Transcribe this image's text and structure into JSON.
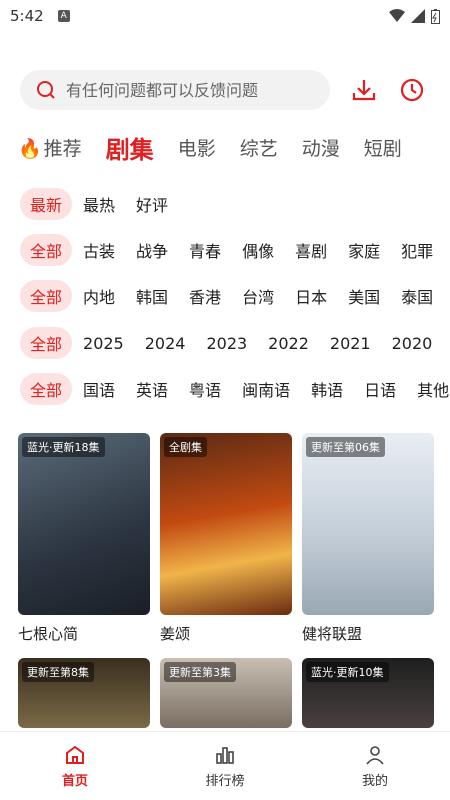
{
  "status": {
    "time": "5:42"
  },
  "search": {
    "placeholder": "有任何问题都可以反馈问题"
  },
  "tabs": [
    "推荐",
    "剧集",
    "电影",
    "综艺",
    "动漫",
    "短剧"
  ],
  "filters": {
    "sort": {
      "selected": "最新",
      "items": [
        "最热",
        "好评"
      ]
    },
    "genre": {
      "selected": "全部",
      "items": [
        "古装",
        "战争",
        "青春",
        "偶像",
        "喜剧",
        "家庭",
        "犯罪"
      ]
    },
    "region": {
      "selected": "全部",
      "items": [
        "内地",
        "韩国",
        "香港",
        "台湾",
        "日本",
        "美国",
        "泰国"
      ]
    },
    "year": {
      "selected": "全部",
      "items": [
        "2025",
        "2024",
        "2023",
        "2022",
        "2021",
        "2020"
      ]
    },
    "language": {
      "selected": "全部",
      "items": [
        "国语",
        "英语",
        "粤语",
        "闽南语",
        "韩语",
        "日语",
        "其他"
      ]
    }
  },
  "cards": [
    {
      "badge": "蓝光·更新18集",
      "title": "七根心简",
      "color": "#3a4a5a"
    },
    {
      "badge": "全剧集",
      "title": "姜颂",
      "color": "#c55a1e"
    },
    {
      "badge": "更新至第06集",
      "title": "健将联盟",
      "color": "#cfd8e0"
    },
    {
      "badge": "更新至第8集",
      "title": "",
      "color": "#6b5a3a"
    },
    {
      "badge": "更新至第3集",
      "title": "",
      "color": "#8a7a6a"
    },
    {
      "badge": "蓝光·更新10集",
      "title": "",
      "color": "#2a2a2a"
    }
  ],
  "nav": [
    {
      "label": "首页",
      "icon": "home-icon"
    },
    {
      "label": "排行榜",
      "icon": "chart-icon"
    },
    {
      "label": "我的",
      "icon": "user-icon"
    }
  ],
  "colors": {
    "accent": "#e02020"
  }
}
